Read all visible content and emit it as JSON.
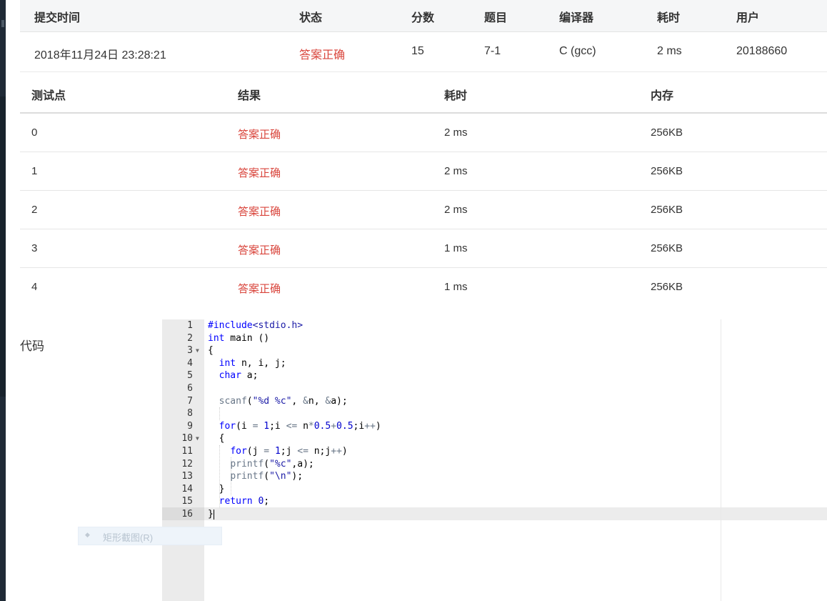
{
  "submission": {
    "headers": [
      "提交时间",
      "状态",
      "分数",
      "题目",
      "编译器",
      "耗时",
      "用户"
    ],
    "row": {
      "time": "2018年11月24日 23:28:21",
      "status": "答案正确",
      "score": "15",
      "problem": "7-1",
      "compiler": "C (gcc)",
      "cost": "2 ms",
      "user": "20188660"
    }
  },
  "testcases": {
    "headers": [
      "测试点",
      "结果",
      "耗时",
      "内存"
    ],
    "rows": [
      {
        "id": "0",
        "result": "答案正确",
        "time": "2 ms",
        "memory": "256KB"
      },
      {
        "id": "1",
        "result": "答案正确",
        "time": "2 ms",
        "memory": "256KB"
      },
      {
        "id": "2",
        "result": "答案正确",
        "time": "2 ms",
        "memory": "256KB"
      },
      {
        "id": "3",
        "result": "答案正确",
        "time": "1 ms",
        "memory": "256KB"
      },
      {
        "id": "4",
        "result": "答案正确",
        "time": "1 ms",
        "memory": "256KB"
      }
    ]
  },
  "code": {
    "label": "代码",
    "line_numbers": [
      "1",
      "2",
      "3",
      "4",
      "5",
      "6",
      "7",
      "8",
      "9",
      "10",
      "11",
      "12",
      "13",
      "14",
      "15",
      "16"
    ],
    "lines": [
      "#include<stdio.h>",
      "int main ()",
      "{",
      "  int n, i, j;",
      "  char a;",
      "",
      "  scanf(\"%d %c\", &n, &a);",
      "",
      "  for(i = 1;i <= n*0.5+0.5;i++)",
      "  {",
      "    for(j = 1;j <= n;j++)",
      "    printf(\"%c\",a);",
      "    printf(\"\\n\");",
      "  }",
      "  return 0;",
      "}"
    ]
  },
  "context_menu": {
    "item": "矩形截图(R)"
  },
  "colors": {
    "accepted": "#d9453c",
    "sidebar": "#1f2a36",
    "keyword": "#0000ff"
  }
}
